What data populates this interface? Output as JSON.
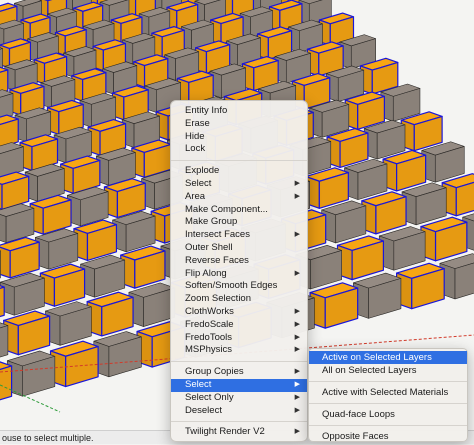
{
  "status_bar": {
    "text": "ouse to select multiple."
  },
  "context_menu": {
    "items": [
      {
        "label": "Entity Info"
      },
      {
        "label": "Erase"
      },
      {
        "label": "Hide"
      },
      {
        "label": "Lock"
      },
      {
        "label": "Explode"
      },
      {
        "label": "Select",
        "submenu": true
      },
      {
        "label": "Area",
        "submenu": true
      },
      {
        "label": "Make Component..."
      },
      {
        "label": "Make Group"
      },
      {
        "label": "Intersect Faces",
        "submenu": true
      },
      {
        "label": "Outer Shell"
      },
      {
        "label": "Reverse Faces"
      },
      {
        "label": "Flip Along",
        "submenu": true
      },
      {
        "label": "Soften/Smooth Edges"
      },
      {
        "label": "Zoom Selection"
      },
      {
        "label": "ClothWorks",
        "submenu": true
      },
      {
        "label": "FredoScale",
        "submenu": true
      },
      {
        "label": "FredoTools",
        "submenu": true
      },
      {
        "label": "MSPhysics",
        "submenu": true
      },
      {
        "label": "Group Copies",
        "submenu": true
      },
      {
        "label": "Select",
        "submenu": true
      },
      {
        "label": "Select Only",
        "submenu": true
      },
      {
        "label": "Deselect",
        "submenu": true
      },
      {
        "label": "Twilight Render V2",
        "submenu": true
      }
    ],
    "arrow_glyph": "▶"
  },
  "select_submenu": {
    "items": [
      {
        "label": "Active on Selected Layers"
      },
      {
        "label": "All on Selected Layers"
      },
      {
        "label": "Active with Selected Materials"
      },
      {
        "label": "Quad-face Loops"
      },
      {
        "label": "Opposite Faces"
      }
    ]
  },
  "colors": {
    "orange_box": "#e69a12",
    "grey_box": "#8a8179",
    "selection_edge": "#1a16d8",
    "menu_highlight": "#2f6fe2"
  }
}
